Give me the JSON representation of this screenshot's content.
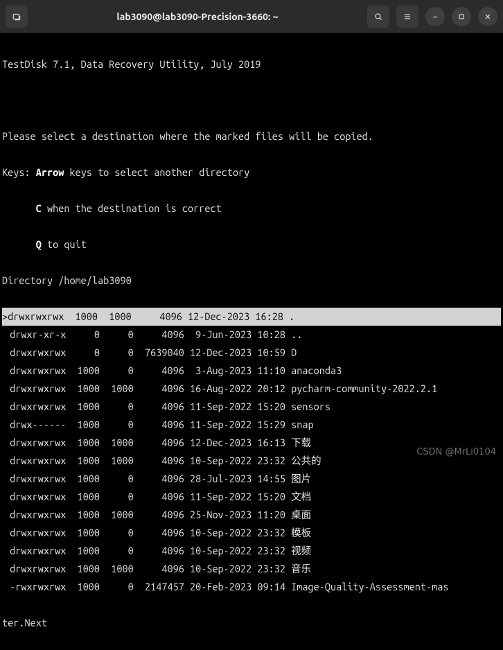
{
  "window": {
    "title": "lab3090@lab3090-Precision-3660: ~"
  },
  "header": {
    "app_line": "TestDisk 7.1, Data Recovery Utility, July 2019",
    "prompt_line": "Please select a destination where the marked files will be copied.",
    "keys_label": "Keys: ",
    "arrow_key": "Arrow",
    "arrow_desc": " keys to select another directory",
    "c_key": "C",
    "c_desc": " when the destination is correct",
    "q_key": "Q",
    "q_desc": " to quit",
    "dir_line": "Directory /home/lab3090"
  },
  "rows": [
    {
      "sel": true,
      "perm": "drwxrwxrwx",
      "uid": "1000",
      "gid": "1000",
      "size": "4096",
      "date": "12-Dec-2023 16:28",
      "name": "."
    },
    {
      "sel": false,
      "perm": "drwxr-xr-x",
      "uid": "0",
      "gid": "0",
      "size": "4096",
      "date": " 9-Jun-2023 10:28",
      "name": ".."
    },
    {
      "sel": false,
      "perm": "drwxrwxrwx",
      "uid": "0",
      "gid": "0",
      "size": "7639040",
      "date": "12-Dec-2023 10:59",
      "name": "D"
    },
    {
      "sel": false,
      "perm": "drwxrwxrwx",
      "uid": "1000",
      "gid": "0",
      "size": "4096",
      "date": " 3-Aug-2023 11:10",
      "name": "anaconda3"
    },
    {
      "sel": false,
      "perm": "drwxrwxrwx",
      "uid": "1000",
      "gid": "1000",
      "size": "4096",
      "date": "16-Aug-2022 20:12",
      "name": "pycharm-community-2022.2.1"
    },
    {
      "sel": false,
      "perm": "drwxrwxrwx",
      "uid": "1000",
      "gid": "0",
      "size": "4096",
      "date": "11-Sep-2022 15:20",
      "name": "sensors"
    },
    {
      "sel": false,
      "perm": "drwx------",
      "uid": "1000",
      "gid": "0",
      "size": "4096",
      "date": "11-Sep-2022 15:29",
      "name": "snap"
    },
    {
      "sel": false,
      "perm": "drwxrwxrwx",
      "uid": "1000",
      "gid": "1000",
      "size": "4096",
      "date": "12-Dec-2023 16:13",
      "name": "下载"
    },
    {
      "sel": false,
      "perm": "drwxrwxrwx",
      "uid": "1000",
      "gid": "1000",
      "size": "4096",
      "date": "10-Sep-2022 23:32",
      "name": "公共的"
    },
    {
      "sel": false,
      "perm": "drwxrwxrwx",
      "uid": "1000",
      "gid": "0",
      "size": "4096",
      "date": "28-Jul-2023 14:55",
      "name": "图片"
    },
    {
      "sel": false,
      "perm": "drwxrwxrwx",
      "uid": "1000",
      "gid": "0",
      "size": "4096",
      "date": "11-Sep-2022 15:20",
      "name": "文档"
    },
    {
      "sel": false,
      "perm": "drwxrwxrwx",
      "uid": "1000",
      "gid": "1000",
      "size": "4096",
      "date": "25-Nov-2023 11:20",
      "name": "桌面"
    },
    {
      "sel": false,
      "perm": "drwxrwxrwx",
      "uid": "1000",
      "gid": "0",
      "size": "4096",
      "date": "10-Sep-2022 23:32",
      "name": "模板"
    },
    {
      "sel": false,
      "perm": "drwxrwxrwx",
      "uid": "1000",
      "gid": "0",
      "size": "4096",
      "date": "10-Sep-2022 23:32",
      "name": "视频"
    },
    {
      "sel": false,
      "perm": "drwxrwxrwx",
      "uid": "1000",
      "gid": "1000",
      "size": "4096",
      "date": "10-Sep-2022 23:32",
      "name": "音乐"
    },
    {
      "sel": false,
      "perm": "-rwxrwxrwx",
      "uid": "1000",
      "gid": "0",
      "size": "2147457",
      "date": "20-Feb-2023 09:14",
      "name": "Image-Quality-Assessment-mas"
    }
  ],
  "footer": {
    "wrap": "ter.Next"
  },
  "watermark": "CSDN @MrLi0104"
}
